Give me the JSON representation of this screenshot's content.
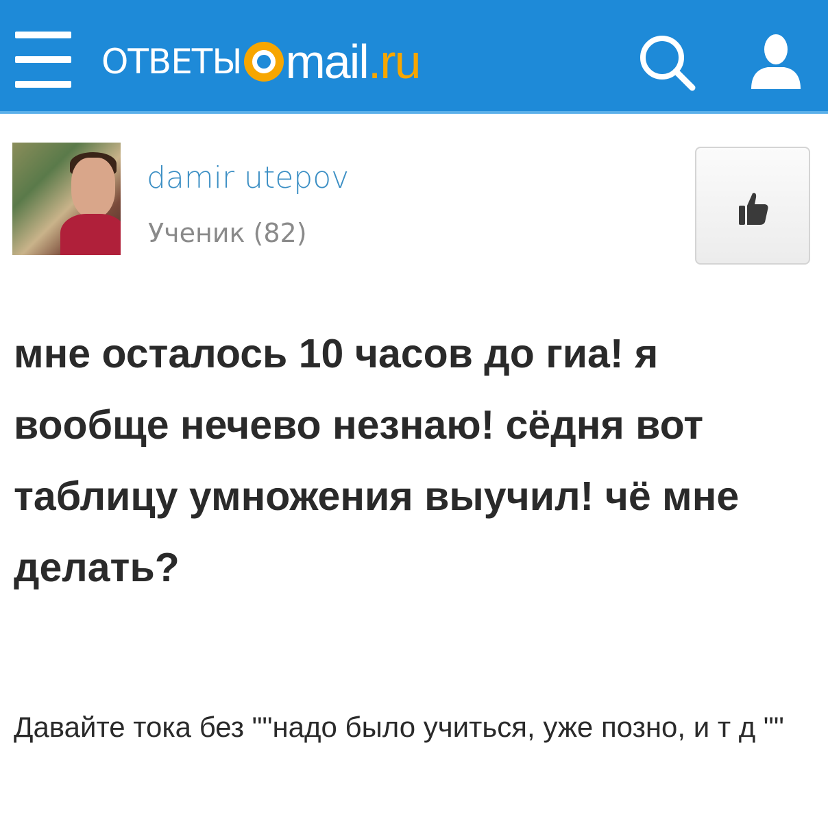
{
  "header": {
    "logo_otvety": "ОТВЕТЫ",
    "logo_mail": "mail",
    "logo_ru": ".ru",
    "bg_color": "#1e8ad8",
    "accent_color": "#f7a600",
    "menu_icon": "hamburger-menu-icon",
    "search_icon": "search-icon",
    "profile_icon": "user-profile-icon"
  },
  "author": {
    "name": "damir utepov",
    "rank": "Ученик (82)"
  },
  "like_button": {
    "icon": "thumbs-up-icon"
  },
  "question": {
    "text": "мне осталось 10 часов до гиа! я вообще нечево незнаю! сёдня вот таблицу умножения выучил! чё мне делать?"
  },
  "comment": {
    "text": "Давайте тока без \"\"надо было учиться, уже позно, и т д \"\""
  }
}
